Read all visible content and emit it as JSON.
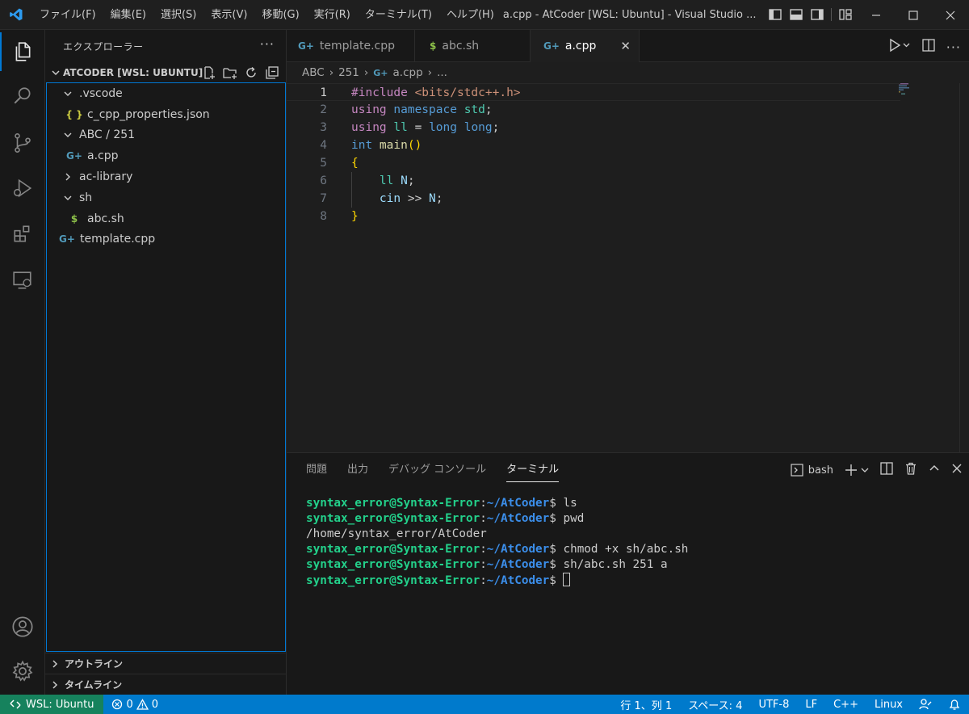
{
  "titlebar": {
    "menu": [
      "ファイル(F)",
      "編集(E)",
      "選択(S)",
      "表示(V)",
      "移動(G)",
      "実行(R)",
      "ターミナル(T)",
      "ヘルプ(H)"
    ],
    "window_title": "a.cpp - AtCoder [WSL: Ubuntu] - Visual Studio ..."
  },
  "sidebar": {
    "header": "エクスプローラー",
    "workspace": "ATCODER [WSL: UBUNTU]",
    "tree": [
      {
        "label": ".vscode",
        "type": "folder",
        "expanded": true,
        "depth": 0
      },
      {
        "label": "c_cpp_properties.json",
        "type": "json",
        "depth": 1
      },
      {
        "label": "ABC / 251",
        "type": "folder",
        "expanded": true,
        "depth": 0
      },
      {
        "label": "a.cpp",
        "type": "cpp",
        "depth": 1
      },
      {
        "label": "ac-library",
        "type": "folder",
        "expanded": false,
        "depth": 0
      },
      {
        "label": "sh",
        "type": "folder",
        "expanded": true,
        "depth": 0
      },
      {
        "label": "abc.sh",
        "type": "sh",
        "depth": 1
      },
      {
        "label": "template.cpp",
        "type": "cpp",
        "depth": 0
      }
    ],
    "outline": "アウトライン",
    "timeline": "タイムライン"
  },
  "tabs": [
    {
      "label": "template.cpp",
      "icon": "cpp"
    },
    {
      "label": "abc.sh",
      "icon": "sh"
    },
    {
      "label": "a.cpp",
      "icon": "cpp",
      "active": true
    }
  ],
  "breadcrumb": [
    "ABC",
    "251",
    "a.cpp",
    "..."
  ],
  "code": {
    "line_numbers": [
      "1",
      "2",
      "3",
      "4",
      "5",
      "6",
      "7",
      "8"
    ],
    "lines": [
      [
        {
          "t": "#include ",
          "c": "#c586c0"
        },
        {
          "t": "<bits/stdc++.h>",
          "c": "#ce9178"
        }
      ],
      [
        {
          "t": "using ",
          "c": "#c586c0"
        },
        {
          "t": "namespace ",
          "c": "#569cd6"
        },
        {
          "t": "std",
          "c": "#4ec9b0"
        },
        {
          "t": ";",
          "c": "#cccccc"
        }
      ],
      [
        {
          "t": "using ",
          "c": "#c586c0"
        },
        {
          "t": "ll",
          "c": "#4ec9b0"
        },
        {
          "t": " = ",
          "c": "#cccccc"
        },
        {
          "t": "long long",
          "c": "#569cd6"
        },
        {
          "t": ";",
          "c": "#cccccc"
        }
      ],
      [
        {
          "t": "int ",
          "c": "#569cd6"
        },
        {
          "t": "main",
          "c": "#dcdcaa"
        },
        {
          "t": "()",
          "c": "#ffd700"
        }
      ],
      [
        {
          "t": "{",
          "c": "#ffd700"
        }
      ],
      [
        {
          "t": "    ",
          "c": "#cccccc"
        },
        {
          "t": "ll ",
          "c": "#4ec9b0"
        },
        {
          "t": "N",
          "c": "#9cdcfe"
        },
        {
          "t": ";",
          "c": "#cccccc"
        }
      ],
      [
        {
          "t": "    ",
          "c": "#cccccc"
        },
        {
          "t": "cin",
          "c": "#9cdcfe"
        },
        {
          "t": " >> ",
          "c": "#cccccc"
        },
        {
          "t": "N",
          "c": "#9cdcfe"
        },
        {
          "t": ";",
          "c": "#cccccc"
        }
      ],
      [
        {
          "t": "}",
          "c": "#ffd700"
        }
      ]
    ]
  },
  "panel": {
    "tabs": [
      "問題",
      "出力",
      "デバッグ コンソール",
      "ターミナル"
    ],
    "active_tab": 3,
    "shell": "bash",
    "prompt_user": "syntax_error@Syntax-Error",
    "prompt_path": "~/AtCoder",
    "terminal": [
      {
        "kind": "cmd",
        "text": " ls"
      },
      {
        "kind": "cmd",
        "text": " pwd"
      },
      {
        "kind": "out",
        "text": "/home/syntax_error/AtCoder"
      },
      {
        "kind": "cmd",
        "text": " chmod +x sh/abc.sh"
      },
      {
        "kind": "cmd",
        "text": " sh/abc.sh 251 a"
      },
      {
        "kind": "cmd",
        "text": " ",
        "cursor": true
      }
    ]
  },
  "status": {
    "remote": "WSL: Ubuntu",
    "errors": "0",
    "warnings": "0",
    "position": "行 1、列 1",
    "spaces": "スペース: 4",
    "encoding": "UTF-8",
    "eol": "LF",
    "language": "C++",
    "os": "Linux"
  }
}
